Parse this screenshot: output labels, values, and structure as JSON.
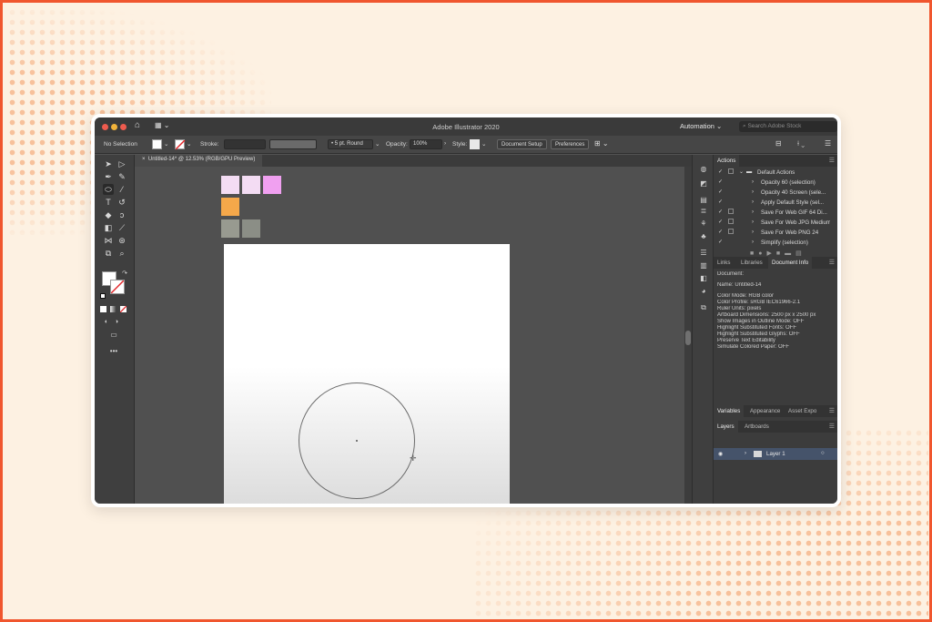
{
  "window": {
    "title": "Adobe Illustrator 2020",
    "workspace": "Automation",
    "search_placeholder": "Search Adobe Stock"
  },
  "control_bar": {
    "selection": "No Selection",
    "stroke_label": "Stroke:",
    "brush": "5 pt. Round",
    "opacity_label": "Opacity:",
    "opacity_value": "100%",
    "style_label": "Style:",
    "document_setup": "Document Setup",
    "preferences": "Preferences"
  },
  "document_tab": "Untitled-14* @ 12.53% (RGB/GPU Preview)",
  "swatches": {
    "row1": [
      "#f3dcf3",
      "#f3dcf3",
      "#f0a0f0"
    ],
    "row2": [
      "#f5a84a"
    ],
    "row3": [
      "#989a90",
      "#8b8e86"
    ]
  },
  "panels": {
    "actions": {
      "tab": "Actions",
      "set_name": "Default Actions",
      "items": [
        "Opacity 60 (selection)",
        "Opacity 40 Screen (sele...",
        "Apply Default Style (sel...",
        "Save For Web GIF 64 Di...",
        "Save For Web JPG Medium",
        "Save For Web PNG 24",
        "Simplify (selection)"
      ]
    },
    "doc_tabs": [
      "Links",
      "Libraries",
      "Document Info"
    ],
    "document_info": {
      "heading": "Document:",
      "name": "Name: Untitled-14",
      "lines": [
        "Color Mode: RGB color",
        "Color Profile: sRGB IEC61966-2.1",
        "Ruler Units: pixels",
        "Artboard Dimensions: 2500 px x 2500 px",
        "Show Images in Outline Mode: OFF",
        "Highlight Substituted Fonts: OFF",
        "Highlight Substituted Glyphs: OFF",
        "Preserve Text Editability",
        "Simulate Colored Paper: OFF"
      ]
    },
    "var_tabs": [
      "Variables",
      "Appearance",
      "Asset Expo"
    ],
    "layer_tabs": [
      "Layers",
      "Artboards"
    ],
    "layer_name": "Layer 1"
  }
}
